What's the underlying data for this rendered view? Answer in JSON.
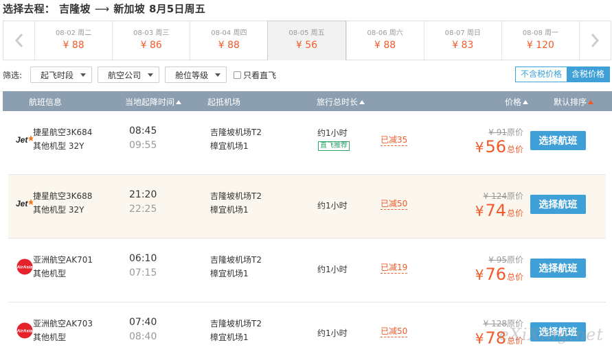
{
  "header": {
    "prefix": "选择去程：",
    "from": "吉隆坡",
    "arrow": "⟶",
    "to": "新加坡",
    "date": "8月5日周五"
  },
  "date_strip": [
    {
      "date": "08-02 周二",
      "price": "¥ 88"
    },
    {
      "date": "08-03 周三",
      "price": "¥ 86"
    },
    {
      "date": "08-04 周四",
      "price": "¥ 88"
    },
    {
      "date": "08-05 周五",
      "price": "¥ 56",
      "selected": true
    },
    {
      "date": "08-06 周六",
      "price": "¥ 88"
    },
    {
      "date": "08-07 周日",
      "price": "¥ 83"
    },
    {
      "date": "08-08 周一",
      "price": "¥ 120"
    }
  ],
  "filters": {
    "label": "筛选:",
    "departure_time": "起飞时段",
    "airline": "航空公司",
    "cabin": "舱位等级",
    "direct_only": "只看直飞",
    "tax_excluded": "不含税价格",
    "tax_included": "含税价格"
  },
  "columns": {
    "flight_info": "航班信息",
    "local_time": "当地起降时间",
    "airports": "起抵机场",
    "duration": "旅行总时长",
    "price": "价格",
    "sort": "默认排序"
  },
  "flights": [
    {
      "logo": "jetstar-logo",
      "airline": "捷星航空3K684",
      "aircraft": "其他机型 32Y",
      "dep": "08:45",
      "arr": "09:55",
      "from": "吉隆坡机场T2",
      "to": "樟宜机场1",
      "duration": "约1小时",
      "tag": "直飞推荐",
      "discount": "已减35",
      "orig_price": "¥ 91",
      "orig_label": "原价",
      "yen": "¥",
      "price": "56",
      "price_label": "总价",
      "button": "选择航班"
    },
    {
      "logo": "jetstar-logo",
      "airline": "捷星航空3K688",
      "aircraft": "其他机型 32Y",
      "dep": "21:20",
      "arr": "22:25",
      "from": "吉隆坡机场T2",
      "to": "樟宜机场1",
      "duration": "约1小时",
      "tag": "",
      "discount": "已减50",
      "orig_price": "¥ 124",
      "orig_label": "原价",
      "yen": "¥",
      "price": "74",
      "price_label": "总价",
      "button": "选择航班"
    },
    {
      "logo": "airasia-logo",
      "airline": "亚洲航空AK701",
      "aircraft": "其他机型",
      "dep": "06:10",
      "arr": "07:15",
      "from": "吉隆坡机场T2",
      "to": "樟宜机场1",
      "duration": "约1小时",
      "tag": "",
      "discount": "已减19",
      "orig_price": "¥ 95",
      "orig_label": "原价",
      "yen": "¥",
      "price": "76",
      "price_label": "总价",
      "button": "选择航班"
    },
    {
      "logo": "airasia-logo",
      "airline": "亚洲航空AK703",
      "aircraft": "其他机型",
      "dep": "07:40",
      "arr": "08:40",
      "from": "吉隆坡机场T2",
      "to": "樟宜机场1",
      "duration": "约1小时",
      "tag": "",
      "discount": "已减50",
      "orig_price": "¥ 128",
      "orig_label": "原价",
      "yen": "¥",
      "price": "78",
      "price_label": "总价",
      "button": "选择航班"
    }
  ],
  "watermark": "eXiXing.net",
  "colors": {
    "accent": "#3ea0d6",
    "price": "#f25a29",
    "header_bar": "#8c9fb1",
    "direct_tag": "#2ea46b"
  }
}
